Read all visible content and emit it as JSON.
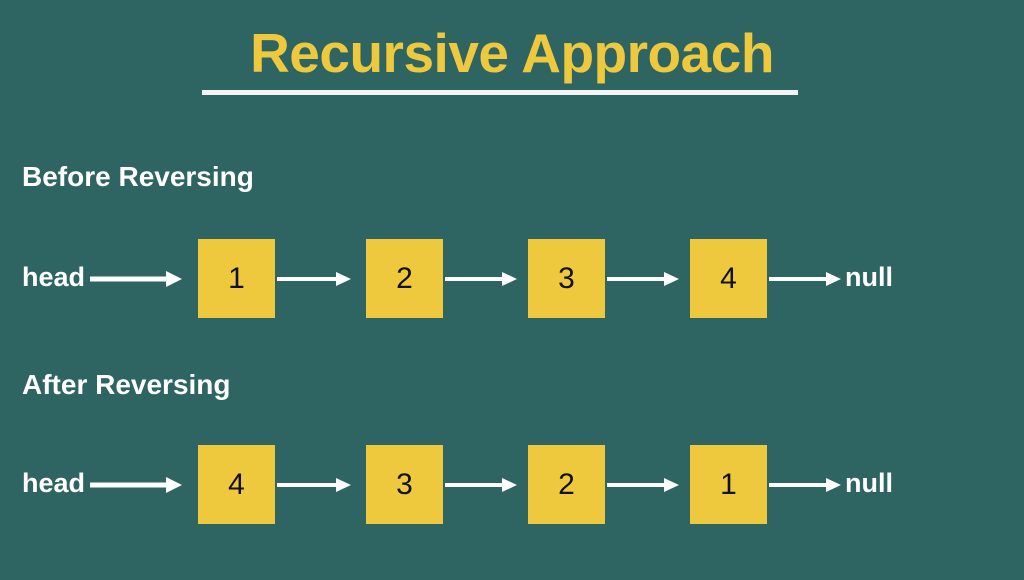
{
  "slide": {
    "background_color": "#2e6461",
    "accent_color": "#efc93d",
    "text_color": "#ffffff",
    "node_text_color": "#111111",
    "title": "Recursive Approach"
  },
  "sections": [
    {
      "heading": "Before Reversing",
      "head_label": "head",
      "null_label": "null",
      "nodes": [
        "1",
        "2",
        "3",
        "4"
      ]
    },
    {
      "heading": "After Reversing",
      "head_label": "head",
      "null_label": "null",
      "nodes": [
        "4",
        "3",
        "2",
        "1"
      ]
    }
  ]
}
